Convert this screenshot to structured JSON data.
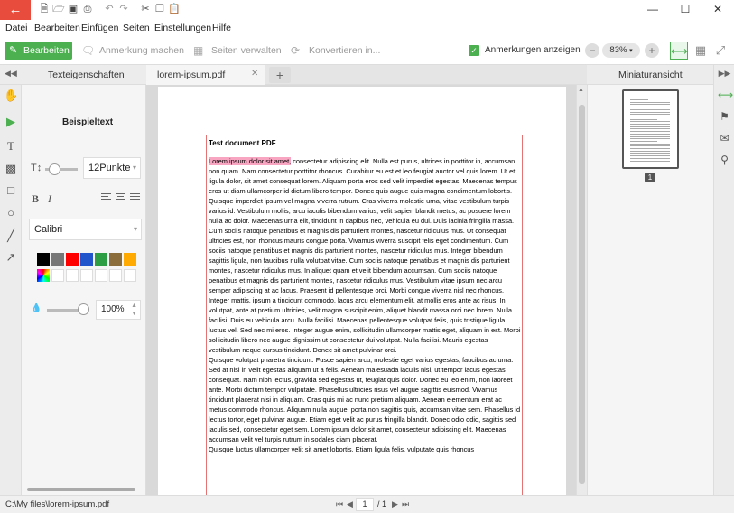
{
  "titlebar": {
    "back_icon": "arrow-left-icon",
    "quick_access": [
      "new-file-icon",
      "open-folder-icon",
      "save-icon",
      "print-icon",
      "undo-icon",
      "redo-icon",
      "cut-icon",
      "copy-icon",
      "paste-icon"
    ],
    "window_controls": [
      "minimize-icon",
      "maximize-icon",
      "close-icon"
    ]
  },
  "menu": {
    "items": [
      {
        "label": "Datei"
      },
      {
        "label": "Bearbeiten"
      },
      {
        "label": "Einfügen"
      },
      {
        "label": "Seiten"
      },
      {
        "label": "Einstellungen"
      },
      {
        "label": "Hilfe"
      }
    ]
  },
  "toolbar": {
    "edit_label": "Bearbeiten",
    "annotate_label": "Anmerkung machen",
    "manage_pages_label": "Seiten verwalten",
    "convert_label": "Konvertieren in...",
    "show_annotations_label": "Anmerkungen anzeigen",
    "show_annotations_checked": true,
    "zoom_minus": "−",
    "zoom_value": "83%",
    "zoom_plus": "+",
    "accent_color": "#4caf50"
  },
  "left_panel": {
    "title": "Texteigenschaften",
    "sample_text": "Beispieltext",
    "font_size": "12Punkte",
    "font_name": "Calibri",
    "bold_label": "B",
    "italic_label": "I",
    "opacity": "100%",
    "colors": [
      "#000000",
      "#777777",
      "#ff0000",
      "#2255cc",
      "#2e9e44",
      "#8a6d3b",
      "#ffaa00"
    ]
  },
  "tabs": {
    "doc_tab_label": "lorem-ipsum.pdf",
    "new_tab_label": "+"
  },
  "document": {
    "title": "Test document PDF",
    "highlight": "Lorem ipsum dolor sit amet,",
    "body_after_highlight": " consectetur adipiscing elit. Nulla est purus, ultrices in porttitor in, accumsan non quam. Nam consectetur porttitor rhoncus. Curabitur eu est et leo feugiat auctor vel quis lorem. Ut et ligula dolor, sit amet consequat lorem. Aliquam porta eros sed velit imperdiet egestas. Maecenas tempus eros ut diam ullamcorper id dictum libero tempor. Donec quis augue quis magna condimentum lobortis. Quisque imperdiet ipsum vel magna viverra rutrum. Cras viverra molestie urna, vitae vestibulum turpis varius id. Vestibulum mollis, arcu iaculis bibendum varius, velit sapien blandit metus, ac posuere lorem nulla ac dolor. Maecenas urna elit, tincidunt in dapibus nec, vehicula eu dui. Duis lacinia fringilla massa. Cum sociis natoque penatibus et magnis dis parturient montes, nascetur ridiculus mus. Ut consequat ultricies est, non rhoncus mauris congue porta. Vivamus viverra suscipit felis eget condimentum. Cum sociis natoque penatibus et magnis dis parturient montes, nascetur ridiculus mus. Integer bibendum sagittis ligula, non faucibus nulla volutpat vitae. Cum sociis natoque penatibus et magnis dis parturient montes, nascetur ridiculus mus. In aliquet quam et velit bibendum accumsan. Cum sociis natoque penatibus et magnis dis parturient montes, nascetur ridiculus mus. Vestibulum vitae ipsum nec arcu semper adipiscing at ac lacus. Praesent id pellentesque orci. Morbi congue viverra nisl nec rhoncus. Integer mattis, ipsum a tincidunt commodo, lacus arcu elementum elit, at mollis eros ante ac risus. In volutpat, ante at pretium ultricies, velit magna suscipit enim, aliquet blandit massa orci nec lorem. Nulla facilisi. Duis eu vehicula arcu. Nulla facilisi. Maecenas pellentesque volutpat felis, quis tristique ligula luctus vel. Sed nec mi eros. Integer augue enim, sollicitudin ullamcorper mattis eget, aliquam in est. Morbi sollicitudin libero nec augue dignissim ut consectetur dui volutpat. Nulla facilisi. Mauris egestas vestibulum neque cursus tincidunt. Donec sit amet pulvinar orci.",
    "paragraph_2": "Quisque volutpat pharetra tincidunt. Fusce sapien arcu, molestie eget varius egestas, faucibus ac urna. Sed at nisi in velit egestas aliquam ut a felis. Aenean malesuada iaculis nisl, ut tempor lacus egestas consequat. Nam nibh lectus, gravida sed egestas ut, feugiat quis dolor. Donec eu leo enim, non laoreet ante. Morbi dictum tempor vulputate. Phasellus ultricies risus vel augue sagittis euismod. Vivamus tincidunt placerat nisi in aliquam. Cras quis mi ac nunc pretium aliquam. Aenean elementum erat ac metus commodo rhoncus. Aliquam nulla augue, porta non sagittis quis, accumsan vitae sem. Phasellus id lectus tortor, eget pulvinar augue. Etiam eget velit ac purus fringilla blandit. Donec odio odio, sagittis sed iaculis sed, consectetur eget sem. Lorem ipsum dolor sit amet, consectetur adipiscing elit. Maecenas accumsan velit vel turpis rutrum in sodales diam placerat.",
    "paragraph_3": "Quisque luctus ullamcorper velit sit amet lobortis. Etiam ligula felis, vulputate quis rhoncus"
  },
  "right_panel": {
    "title": "Miniaturansicht",
    "thumb_page_number": "1"
  },
  "status": {
    "file_path": "C:\\My files\\lorem-ipsum.pdf",
    "current_page": "1",
    "total_pages": "/ 1"
  }
}
